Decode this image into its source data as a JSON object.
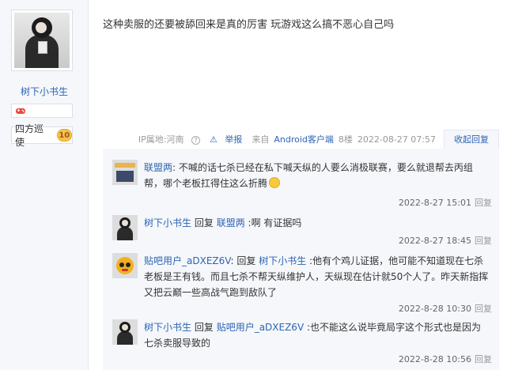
{
  "author": {
    "username": "树下小书生",
    "avatar_icon": "user-avatar-girl",
    "level_icon": "gamepad-icon",
    "title_name": "四方巡使",
    "level": "10"
  },
  "post": {
    "content": "这种卖服的还要被舔回来是真的厉害 玩游戏这么搞不恶心自己吗"
  },
  "meta": {
    "ip_label": "IP属地:河南",
    "help_icon": "?",
    "report_label": "举报",
    "report_icon": "⚠",
    "source_prefix": "来自",
    "source_link": "Android客户端",
    "floor": "8楼",
    "datetime": "2022-08-27 07:57",
    "collapse_label": "收起回复"
  },
  "replies": [
    {
      "user": "联盟两",
      "avatar_icon": "game-avatar",
      "text_prefix": ":",
      "text": "不喊的话七杀已经在私下喊天纵的人要么消极联赛，要么就退帮去丙组帮，哪个老板扛得住这么折腾",
      "time": "2022-8-27 15:01",
      "reply_label": "回复"
    },
    {
      "user": "树下小书生",
      "avatar_icon": "user-avatar-girl",
      "reply_word": "回复",
      "target": "联盟两",
      "text": ":啊 有证据吗",
      "time": "2022-8-27 18:45",
      "reply_label": "回复"
    },
    {
      "user": "贴吧用户_aDXEZ6V",
      "avatar_icon": "bear-avatar",
      "reply_word": "回复",
      "target": "树下小书生",
      "text": ":他有个鸡儿证据，他可能不知道现在七杀老板是王有钱。而且七杀不帮天纵维护人，天纵现在估计就50个人了。昨天新指挥又把云巅一些高战气跑到敌队了",
      "time": "2022-8-28 10:30",
      "reply_label": "回复"
    },
    {
      "user": "树下小书生",
      "avatar_icon": "user-avatar-girl",
      "reply_word": "回复",
      "target": "贴吧用户_aDXEZ6V",
      "text": ":也不能这么说毕竟局字这个形式也是因为七杀卖服导致的",
      "time": "2022-8-28 10:56",
      "reply_label": "回复"
    }
  ]
}
